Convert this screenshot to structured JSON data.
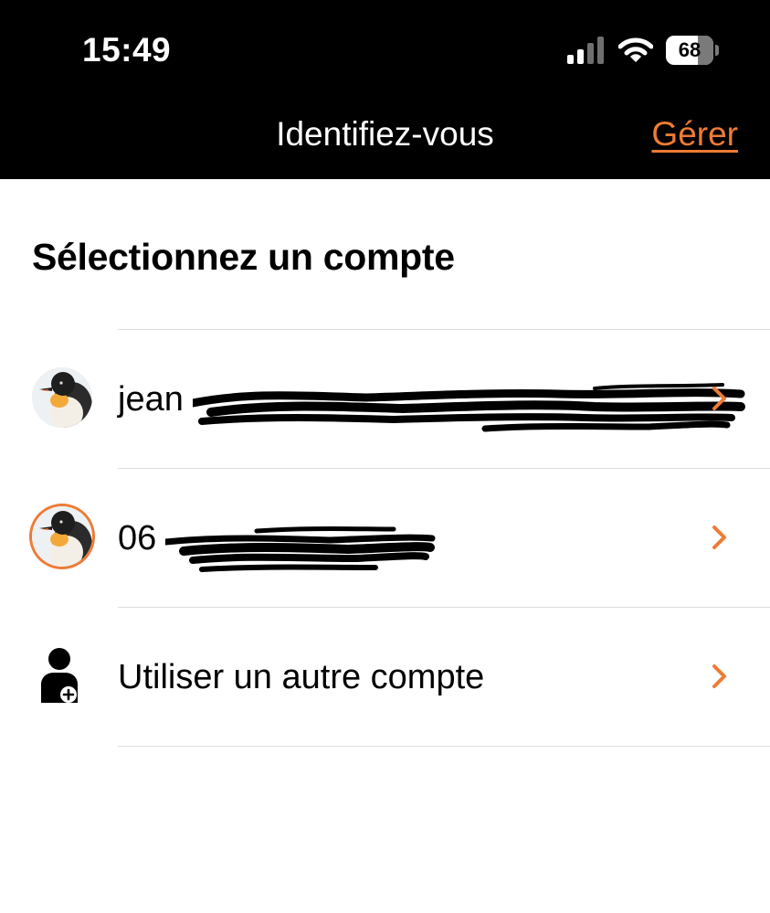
{
  "status_bar": {
    "time": "15:49",
    "battery_level": "68",
    "battery_fraction": 0.68,
    "signal_bars": 2,
    "icons": [
      "signal-icon",
      "wifi-icon",
      "battery-icon"
    ]
  },
  "nav": {
    "title": "Identifiez-vous",
    "manage_label": "Gérer"
  },
  "section": {
    "title": "Sélectionnez un compte"
  },
  "accounts": [
    {
      "label": "jean",
      "avatar": "penguin-avatar",
      "selected": false
    },
    {
      "label": "06",
      "avatar": "penguin-avatar",
      "selected": true
    }
  ],
  "other_account": {
    "label": "Utiliser un autre compte",
    "icon": "user-add-icon"
  },
  "colors": {
    "accent": "#ee7b35",
    "header_bg": "#000000",
    "divider": "#dcdcdc"
  }
}
